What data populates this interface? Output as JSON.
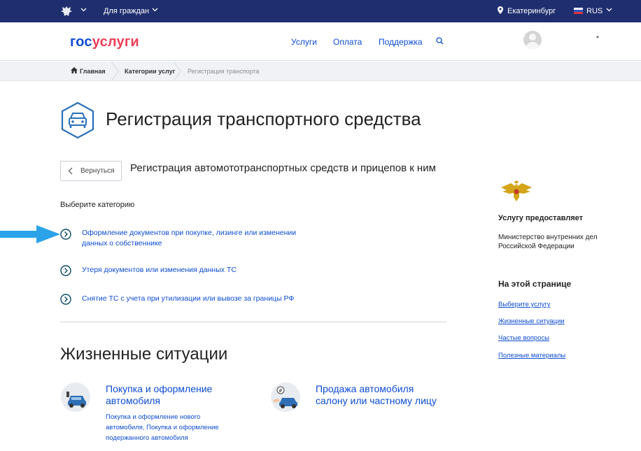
{
  "topbar": {
    "for_citizens": "Для граждан",
    "city": "Екатеринбург",
    "language": "RUS"
  },
  "header": {
    "logo_part1": "гос",
    "logo_part2": "услуги",
    "nav": [
      "Услуги",
      "Оплата",
      "Поддержка"
    ]
  },
  "breadcrumbs": [
    "Главная",
    "Категории услуг",
    "Регистрация транспорта"
  ],
  "main": {
    "page_title": "Регистрация транспортного средства",
    "back_button": "Вернуться",
    "subtitle": "Регистрация автомототранспортных средств и прицепов к ним",
    "choose_category": "Выберите категорию",
    "categories": [
      {
        "line1": "Оформление документов при покупке, лизинге или изменении",
        "line2": "данных о собственнике"
      },
      {
        "line1": "Утеря документов или изменения данных ТС",
        "line2": ""
      },
      {
        "line1": "Снятие ТС с учета при утилизации или вывозе за границы РФ",
        "line2": ""
      }
    ],
    "life_situations_title": "Жизненные ситуации",
    "situations": [
      {
        "title1": "Покупка и оформление",
        "title2": "автомобиля",
        "desc": [
          "Покупка и оформление нового",
          "автомобиля, Покупка и оформление",
          "подержанного автомобиля"
        ]
      },
      {
        "title1": "Продажа автомобиля",
        "title2": "салону или частному лицу",
        "desc": []
      }
    ]
  },
  "sidebar": {
    "provider_label": "Услугу предоставляет",
    "provider_name_line1": "Министерство внутренних дел",
    "provider_name_line2": "Российской Федерации",
    "on_page_label": "На этой странице",
    "on_page_links": [
      "Выберите услугу",
      "Жизненные ситуации",
      "Частые вопросы",
      "Полезные материалы"
    ]
  },
  "colors": {
    "topbar_bg": "#1f2e6e",
    "link_blue": "#0d4cd3",
    "logo_red": "#ee3f58",
    "arrow_blue": "#2aa3e8"
  }
}
